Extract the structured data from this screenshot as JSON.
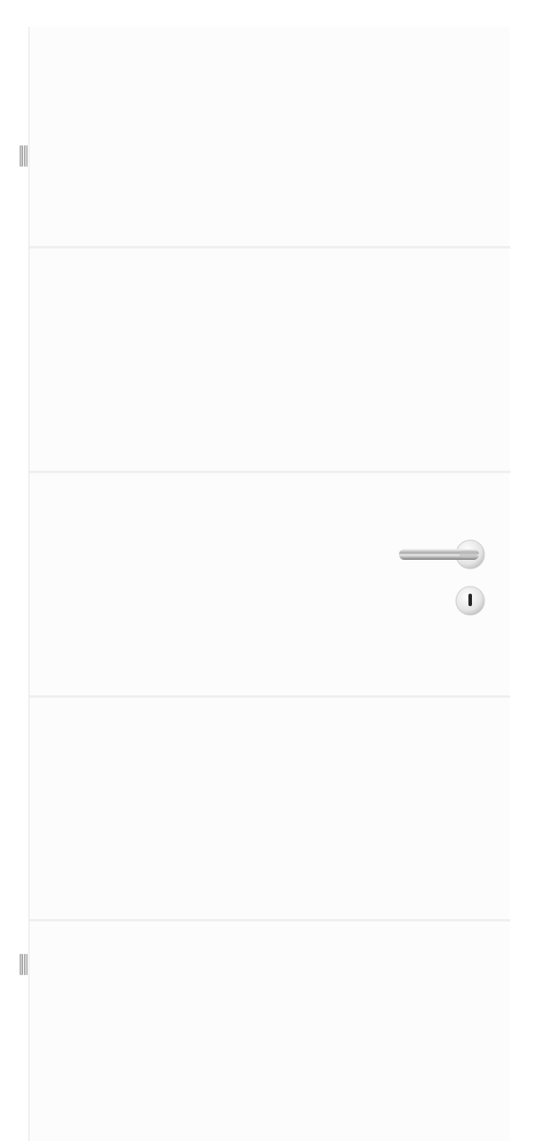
{
  "scene": {
    "subject": "door",
    "colors": {
      "background": "#ffffff",
      "door_panel": "#fcfcfc",
      "groove": "#ececec",
      "hardware": "#c8c8c8"
    },
    "icons": {
      "handle": "lever-handle-icon",
      "keyhole": "keyhole-icon",
      "hinge": "hinge-icon"
    }
  }
}
